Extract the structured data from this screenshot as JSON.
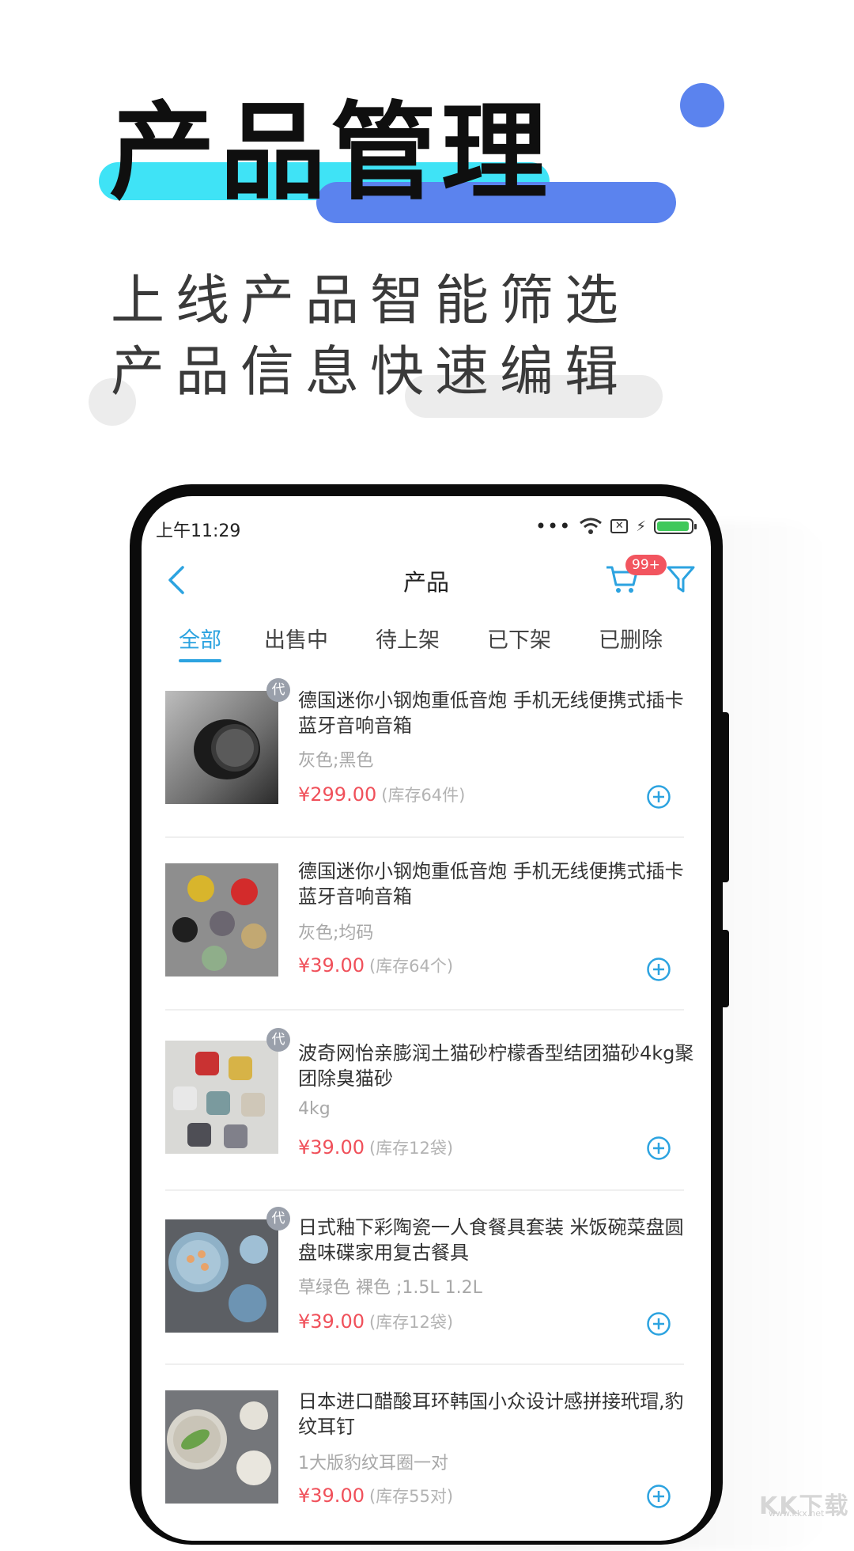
{
  "promo": {
    "headline": "产品管理",
    "subline1": "上线产品智能筛选",
    "subline2": "产品信息快速编辑"
  },
  "status_bar": {
    "time": "上午11:29"
  },
  "nav": {
    "title": "产品",
    "cart_badge": "99+"
  },
  "tabs": [
    {
      "label": "全部",
      "active": true
    },
    {
      "label": "出售中",
      "active": false
    },
    {
      "label": "待上架",
      "active": false
    },
    {
      "label": "已下架",
      "active": false
    },
    {
      "label": "已删除",
      "active": false
    }
  ],
  "products": [
    {
      "title": "德国迷你小钢炮重低音炮 手机无线便携式插卡蓝牙音响音箱",
      "spec": "灰色;黑色",
      "price": "¥299.00",
      "stock": "(库存64件)",
      "badge": "代",
      "image": "speaker-image"
    },
    {
      "title": "德国迷你小钢炮重低音炮 手机无线便携式插卡蓝牙音响音箱",
      "spec": "灰色;均码",
      "price": "¥39.00",
      "stock": "(库存64个)",
      "badge": "",
      "image": "cups-image"
    },
    {
      "title": "波奇网怡亲膨润土猫砂柠檬香型结团猫砂4kg聚团除臭猫砂",
      "spec": "4kg",
      "price": "¥39.00",
      "stock": "(库存12袋)",
      "badge": "代",
      "image": "mugs-image"
    },
    {
      "title": "日式釉下彩陶瓷一人食餐具套装 米饭碗菜盘圆盘味碟家用复古餐具",
      "spec": "草绿色 裸色 ;1.5L 1.2L",
      "price": "¥39.00",
      "stock": "(库存12袋)",
      "badge": "代",
      "image": "plates-image"
    },
    {
      "title": "日本进口醋酸耳环韩国小众设计感拼接玳瑁,豹纹耳钉",
      "spec": "1大版豹纹耳圈一对",
      "price": "¥39.00",
      "stock": "(库存55对)",
      "badge": "",
      "image": "dishes-image"
    }
  ],
  "watermark": {
    "text": "KK下载",
    "url": "www.kkx.net"
  },
  "colors": {
    "accent": "#2ca3e0",
    "price": "#f0505a",
    "badge": "#f2555f",
    "brand_blue": "#5b83ee",
    "brand_cyan": "#3fe3f6"
  }
}
